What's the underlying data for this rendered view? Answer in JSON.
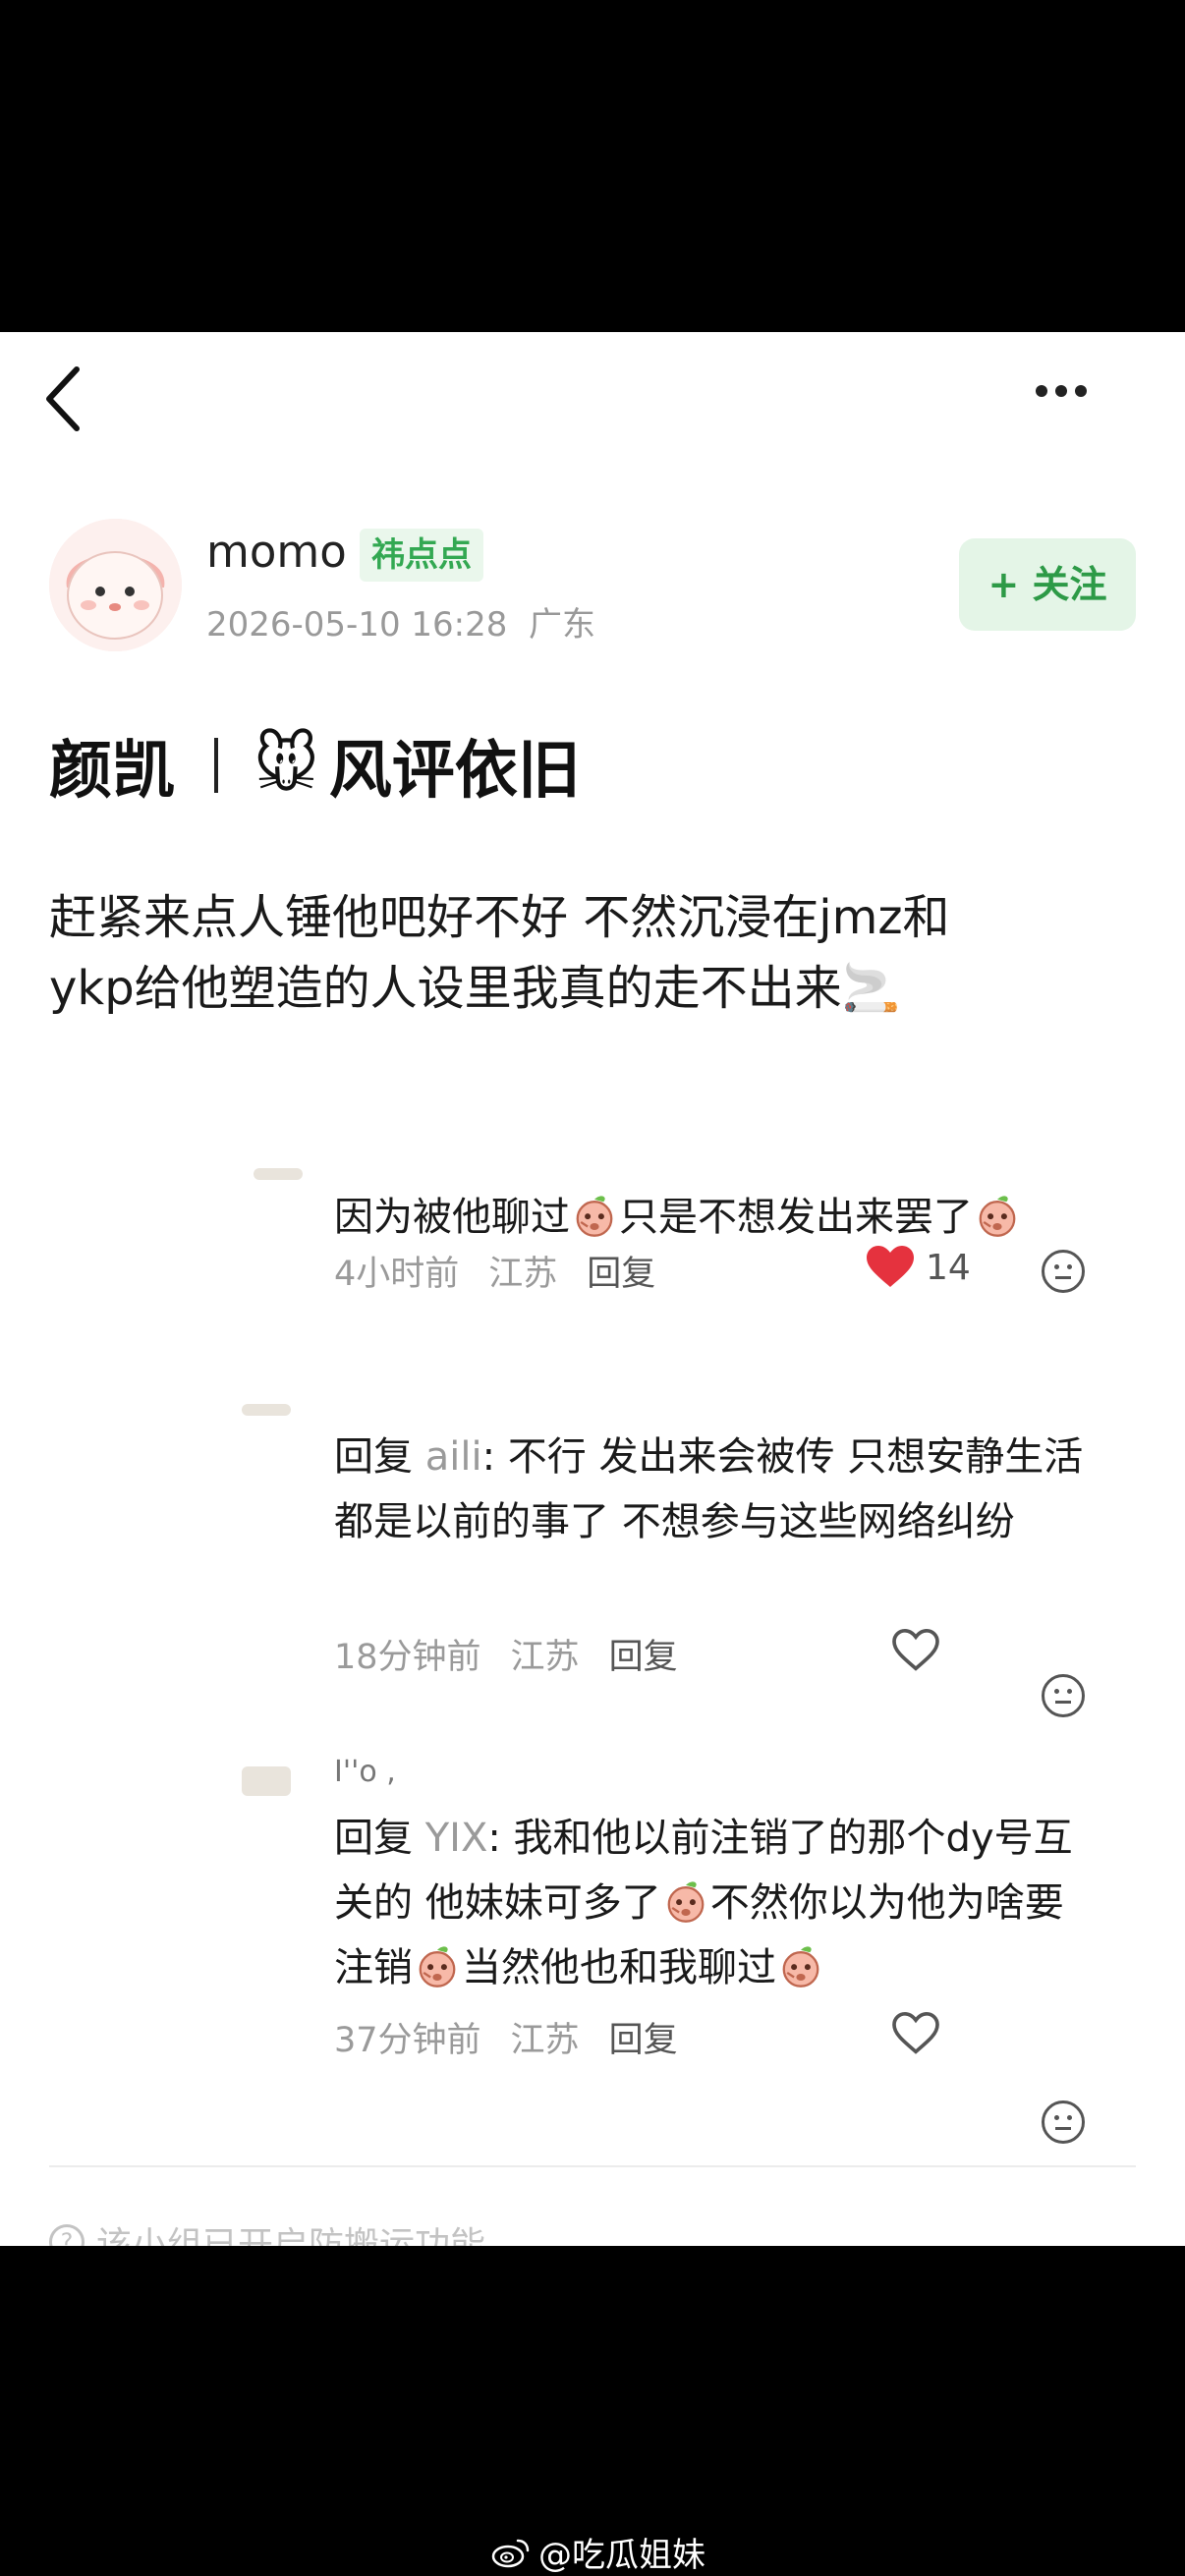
{
  "header": {
    "back_icon": "chevron-left-icon",
    "more_icon": "more-dots-icon"
  },
  "author": {
    "avatar_icon": "cartoon-avatar",
    "name": "momo",
    "group_tag": "祎点点",
    "datetime": "2026-05-10 16:28",
    "location": "广东",
    "follow_label": "+ 关注"
  },
  "post": {
    "title_left": "颜凯",
    "title_emoji": "🐭",
    "title_right": "风评依旧",
    "body_line1": "赶紧来点人锤他吧好不好 不然沉浸在jmz和",
    "body_line2": "ykp给他塑造的人设里我真的走不出来🚬"
  },
  "comments": [
    {
      "text_a": "因为被他聊过",
      "text_b": "只是不想发出来罢了",
      "time": "4小时前",
      "location": "江苏",
      "reply_label": "回复",
      "likes": "14",
      "liked": true
    },
    {
      "reply_prefix": "回复",
      "reply_to": "aili",
      "text": ": 不行 发出来会被传 只想安静生活 都是以前的事了 不想参与这些网络纠纷",
      "time": "18分钟前",
      "location": "江苏",
      "reply_label": "回复",
      "liked": false
    },
    {
      "username_fragment": "I''o ,",
      "reply_prefix": "回复",
      "reply_to": "YIX",
      "text_a": ": 我和他以前注销了的那个dy号互关的 他妹妹可多了",
      "text_b": "不然你以为他为啥要注销",
      "text_c": "当然他也和我聊过",
      "time": "37分钟前",
      "location": "江苏",
      "reply_label": "回复",
      "liked": false
    }
  ],
  "footer": {
    "notice_icon": "question-circle-icon",
    "notice": "该小组已开启防搬运功能"
  },
  "watermark": {
    "icon": "weibo-icon",
    "text": "@吃瓜姐妹"
  },
  "colors": {
    "accent_green": "#33a852",
    "like_red": "#e5323e",
    "meta_gray": "#9a9a9a"
  }
}
